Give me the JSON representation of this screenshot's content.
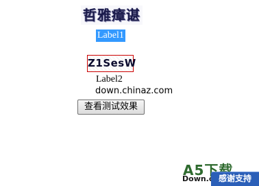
{
  "captcha_1": {
    "text": "哲雅瘴谌"
  },
  "label_1": {
    "text": "Label1"
  },
  "captcha_2": {
    "text": "Z1SesW"
  },
  "label_2": {
    "text": "Label2"
  },
  "domain_line": {
    "text": "down.chinaz.com"
  },
  "button": {
    "label": "查看测试效果"
  },
  "watermark": {
    "logo": "A5下载",
    "sub": "Down.c",
    "badge": "感谢支持"
  }
}
